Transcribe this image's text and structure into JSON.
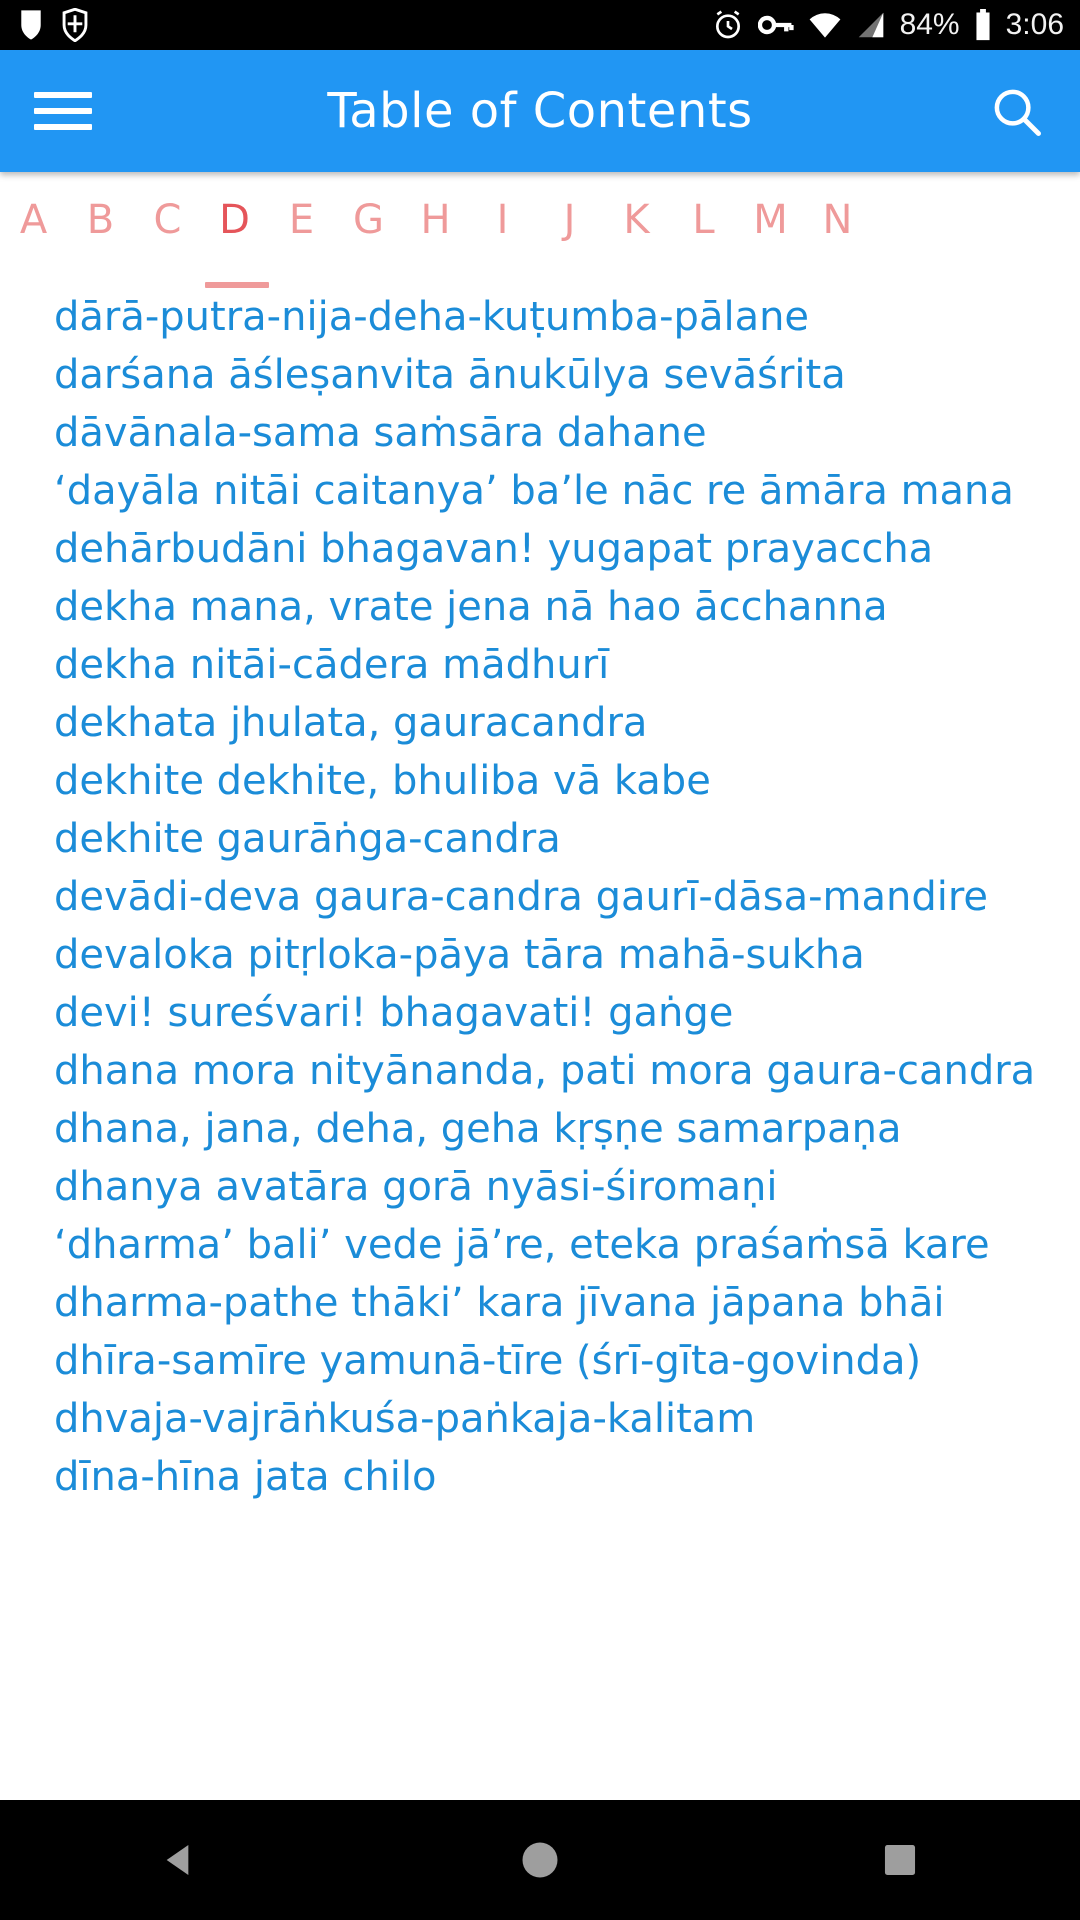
{
  "status_bar": {
    "left_icons": [
      "shield-outline-icon",
      "shield-split-icon"
    ],
    "right_icons": [
      "alarm-icon",
      "vpn-key-icon",
      "wifi-icon",
      "cell-signal-icon",
      "battery-icon"
    ],
    "battery_percent": "84%",
    "time": "3:06"
  },
  "app_bar": {
    "menu_icon": "hamburger-menu-icon",
    "title": "Table of Contents",
    "search_icon": "search-icon",
    "background_color": "#2196f3"
  },
  "tabs": {
    "selected": "D",
    "indicator_color": "#ef9a9a",
    "items": [
      {
        "label": "A"
      },
      {
        "label": "B"
      },
      {
        "label": "C"
      },
      {
        "label": "D"
      },
      {
        "label": "E"
      },
      {
        "label": "G"
      },
      {
        "label": "H"
      },
      {
        "label": "I"
      },
      {
        "label": "J"
      },
      {
        "label": "K"
      },
      {
        "label": "L"
      },
      {
        "label": "M"
      },
      {
        "label": "N"
      }
    ]
  },
  "list": {
    "text_color": "#1b8cd8",
    "items": [
      {
        "title": "dārā-putra-nija-deha-kuṭumba-pālane"
      },
      {
        "title": "darśana āśleṣanvita ānukūlya sevāśrita"
      },
      {
        "title": "dāvānala-sama saṁsāra dahane"
      },
      {
        "title": "‘dayāla nitāi caitanya’ ba’le nāc re āmāra mana"
      },
      {
        "title": "dehārbudāni bhagavan! yugapat prayaccha"
      },
      {
        "title": "dekha mana, vrate jena nā hao ācchanna"
      },
      {
        "title": "dekha nitāi-cādera mādhurī"
      },
      {
        "title": "dekhata jhulata, gauracandra"
      },
      {
        "title": "dekhite dekhite, bhuliba vā kabe"
      },
      {
        "title": "dekhite gaurāṅga-candra"
      },
      {
        "title": "devādi-deva gaura-candra gaurī-dāsa-mandire"
      },
      {
        "title": "devaloka pitṛloka-pāya tāra mahā-sukha"
      },
      {
        "title": "devi! sureśvari! bhagavati! gaṅge"
      },
      {
        "title": "dhana mora nityānanda, pati mora gaura-candra"
      },
      {
        "title": "dhana, jana, deha, geha kṛṣṇe samarpaṇa"
      },
      {
        "title": "dhanya avatāra gorā nyāsi-śiromaṇi"
      },
      {
        "title": "‘dharma’ bali’ vede jā’re, eteka praśaṁsā kare"
      },
      {
        "title": "dharma-pathe thāki’ kara jīvana jāpana bhāi"
      },
      {
        "title": "dhīra-samīre yamunā-tīre (śrī-gīta-govinda)"
      },
      {
        "title": "dhvaja-vajrāṅkuśa-paṅkaja-kalitam"
      },
      {
        "title": "dīna-hīna jata chilo"
      }
    ]
  },
  "nav_bar": {
    "back_icon": "back-triangle-icon",
    "home_icon": "home-circle-icon",
    "recents_icon": "recents-square-icon"
  }
}
